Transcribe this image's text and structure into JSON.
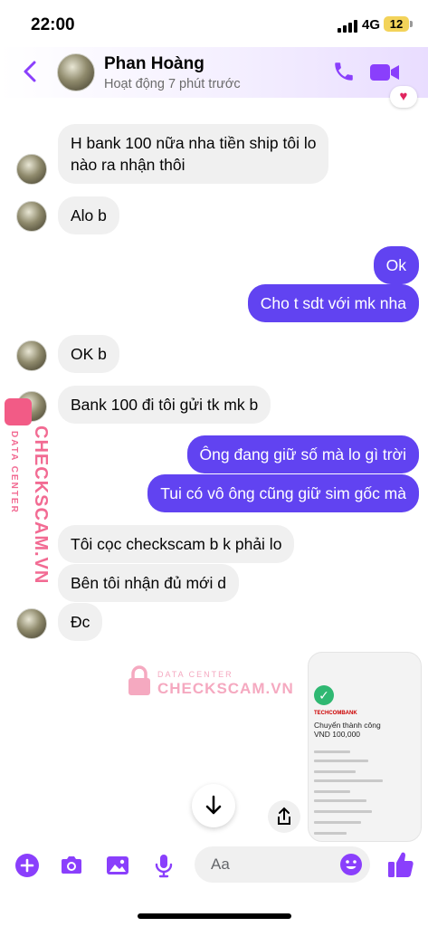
{
  "status_bar": {
    "time": "22:00",
    "network": "4G",
    "battery": "12"
  },
  "header": {
    "name": "Phan Hoàng",
    "status": "Hoạt động 7 phút trước"
  },
  "messages": [
    {
      "side": "in",
      "text": "H bank 100 nữa nha tiền ship tôi lo\nnào ra nhận thôi"
    },
    {
      "side": "in",
      "text": "Alo b"
    },
    {
      "side": "out",
      "text": "Ok"
    },
    {
      "side": "out",
      "text": "Cho t sdt với mk nha"
    },
    {
      "side": "in",
      "text": "OK b"
    },
    {
      "side": "in",
      "text": "Bank 100 đi tôi gửi tk mk b"
    },
    {
      "side": "out",
      "text": "Ông đang giữ số mà lo gì trời"
    },
    {
      "side": "out",
      "text": "Tui có vô ông cũng giữ sim gốc mà"
    },
    {
      "side": "in",
      "text": "Tôi cọc checkscam b k phải lo"
    },
    {
      "side": "in",
      "text": "Bên tôi nhận đủ mới d"
    },
    {
      "side": "in",
      "text": "Đc"
    }
  ],
  "receipt": {
    "bank": "TECHCOMBANK",
    "title": "Chuyển thành công",
    "amount": "VND 100,000"
  },
  "composer": {
    "placeholder": "Aa"
  },
  "watermark": {
    "brand": "CHECKSCAM.VN",
    "sub": "DATA CENTER"
  },
  "colors": {
    "accent": "#6143f1",
    "header_icons": "#8a3ffc",
    "incoming_bubble": "#f0f0f0"
  }
}
